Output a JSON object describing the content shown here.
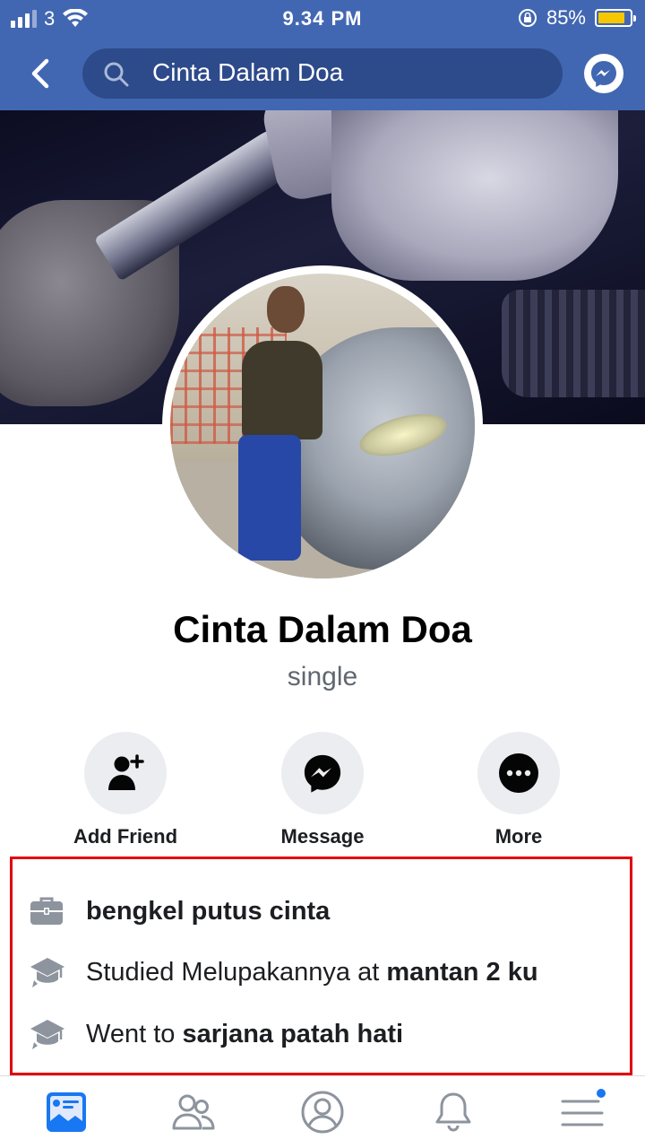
{
  "status_bar": {
    "carrier": "3",
    "time": "9.34 PM",
    "battery_percent": "85%",
    "battery_level": 0.85
  },
  "header": {
    "search_text": "Cinta Dalam Doa",
    "icons": [
      "back-icon",
      "search-icon",
      "messenger-icon"
    ]
  },
  "profile": {
    "name": "Cinta Dalam Doa",
    "subtitle": "single"
  },
  "actions": [
    {
      "label": "Add Friend",
      "icon": "add-friend-icon"
    },
    {
      "label": "Message",
      "icon": "messenger-icon"
    },
    {
      "label": "More",
      "icon": "more-icon"
    }
  ],
  "intro": {
    "work": {
      "bold": "bengkel putus cinta",
      "icon": "briefcase-icon"
    },
    "studied": {
      "prefix": "Studied Melupakannya at ",
      "bold": "mantan 2 ku",
      "icon": "graduation-cap-icon"
    },
    "went_to": {
      "prefix": "Went to ",
      "bold": "sarjana patah hati",
      "icon": "graduation-cap-icon"
    }
  },
  "tabs": [
    {
      "name": "news-feed",
      "active": true
    },
    {
      "name": "friends"
    },
    {
      "name": "profile"
    },
    {
      "name": "notifications"
    },
    {
      "name": "menu",
      "badge": true
    }
  ],
  "colors": {
    "brand_blue": "#4267b2",
    "highlight_box": "#e2000f",
    "badge_blue": "#1877f2"
  }
}
